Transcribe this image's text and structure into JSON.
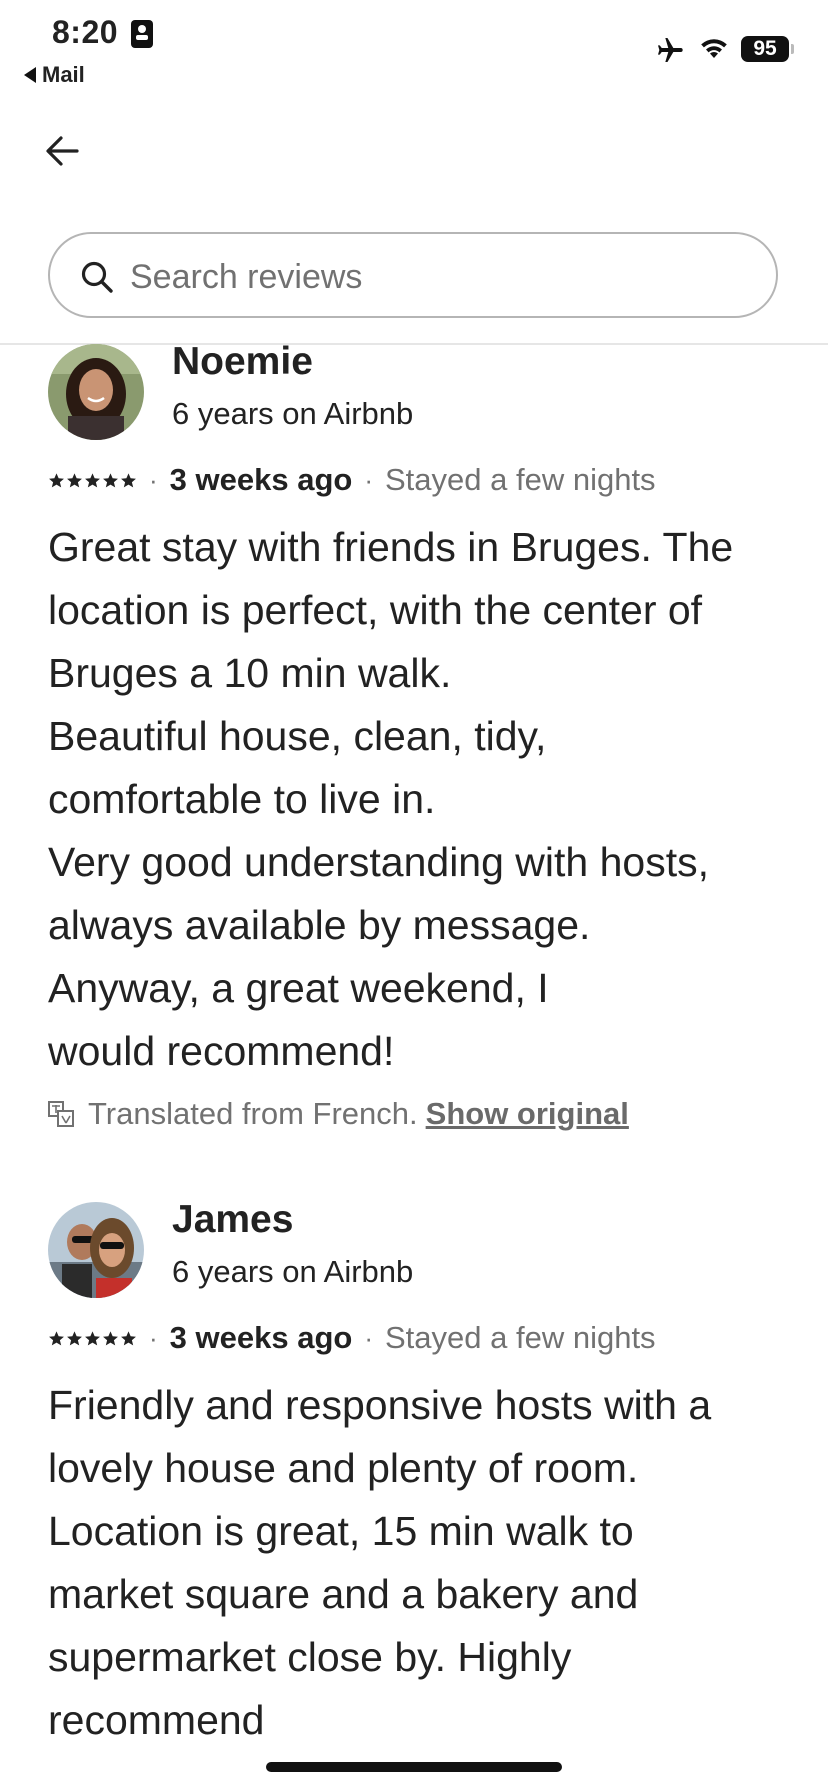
{
  "status_bar": {
    "time": "8:20",
    "back_app": "Mail",
    "battery": "95"
  },
  "search": {
    "placeholder": "Search reviews"
  },
  "reviews": [
    {
      "name": "Noemie",
      "tenure": "6 years on Airbnb",
      "rating": 5,
      "when": "3 weeks ago",
      "stay": "Stayed a few nights",
      "text": "Great stay with friends in Bruges. The\nlocation is perfect, with the center of\nBruges a 10 min walk.\nBeautiful house, clean, tidy,\ncomfortable to live in.\nVery good understanding with hosts,\nalways available by message.\nAnyway, a great weekend, I\nwould recommend!",
      "translated_note": "Translated from French.",
      "show_original": "Show original"
    },
    {
      "name": "James",
      "tenure": "6 years on Airbnb",
      "rating": 5,
      "when": "3 weeks ago",
      "stay": "Stayed a few nights",
      "text": "Friendly and responsive hosts with a\nlovely house and plenty of room.\nLocation is great, 15 min walk to\nmarket square and a bakery and\nsupermarket close by. Highly\nrecommend"
    }
  ],
  "colors": {
    "text_primary": "#222222",
    "text_secondary": "#717171",
    "border": "#b5b5b5",
    "divider": "#e6e6e6"
  },
  "icons": [
    "airplane-icon",
    "wifi-icon",
    "id-card-icon",
    "back-arrow-icon",
    "search-icon",
    "star-icon",
    "translate-icon"
  ]
}
